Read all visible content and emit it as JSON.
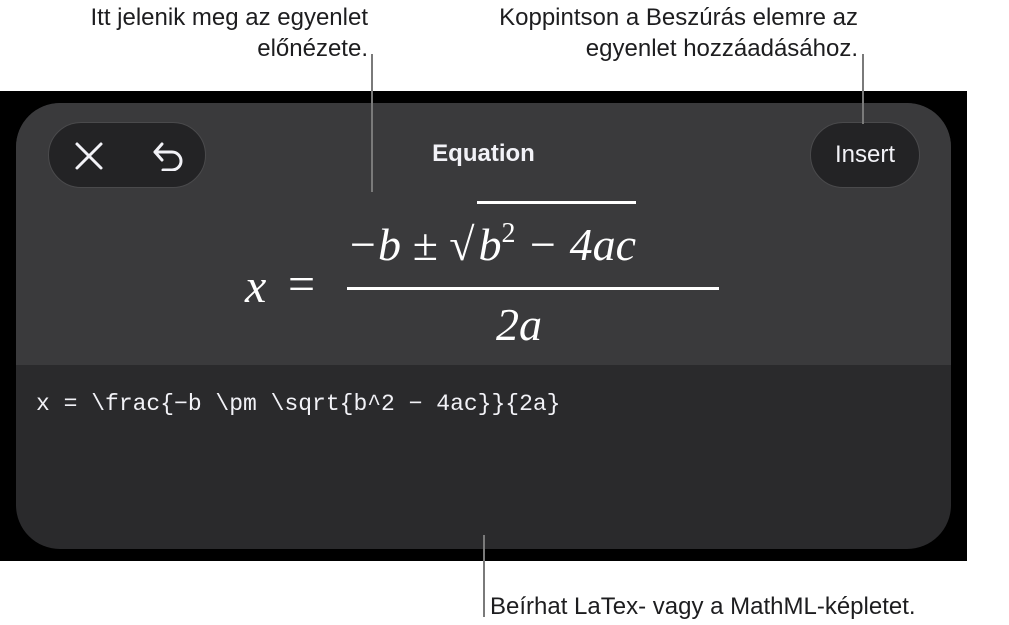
{
  "callouts": {
    "preview_line1": "Itt jelenik meg az egyenlet",
    "preview_line2": "előnézete.",
    "insert_line1": "Koppintson a Beszúrás elemre az",
    "insert_line2": "egyenlet hozzáadásához.",
    "latex": "Beírhat LaTex- vagy a MathML-képletet."
  },
  "sheet": {
    "title": "Equation",
    "insert_label": "Insert",
    "close_icon": "close-icon",
    "undo_icon": "undo-icon"
  },
  "preview": {
    "variable": "x",
    "equals": "=",
    "numerator_prefix": "−b ± ",
    "radicand_base": "b",
    "radicand_exp": "2",
    "radicand_rest": " − 4ac",
    "denominator": "2a"
  },
  "editor": {
    "latex_value": "x = \\frac{−b \\pm \\sqrt{b^2 − 4ac}}{2a}"
  },
  "colors": {
    "backdrop": "#000000",
    "sheet": "#2a2a2c",
    "sheet_top": "#3a3a3c",
    "text": "#f2f2f7"
  }
}
